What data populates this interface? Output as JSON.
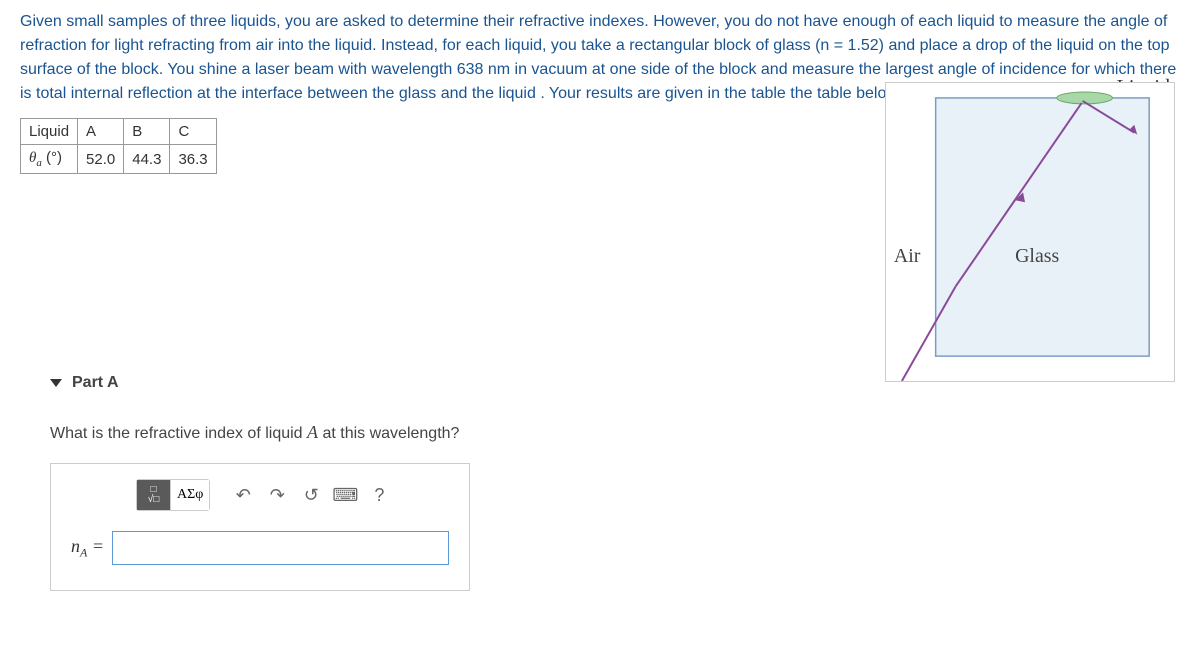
{
  "problem": {
    "text": "Given small samples of three liquids, you are asked to determine their refractive indexes. However, you do not have enough of each liquid to measure the angle of refraction for light refracting from air into the liquid. Instead, for each liquid, you take a rectangular block of glass (n = 1.52) and place a drop of the liquid on the top surface of the block. You shine a laser beam with wavelength 638 nm in vacuum at one side of the block and measure the largest angle of incidence for which there is total internal reflection at the interface between the glass and the liquid . Your results are given in the table the table below."
  },
  "figure": {
    "liquid_label": "Liquid",
    "air_label": "Air",
    "glass_label": "Glass"
  },
  "table": {
    "headers": {
      "liquid": "Liquid",
      "colA": "A",
      "colB": "B",
      "colC": "C"
    },
    "row_label_theta": "θ",
    "row_label_sub": "a",
    "row_label_unit": " (°)",
    "values": {
      "A": "52.0",
      "B": "44.3",
      "C": "36.3"
    }
  },
  "part": {
    "title": "Part A",
    "question_pre": "What is the refractive index of liquid ",
    "question_var": "A",
    "question_post": " at this wavelength?"
  },
  "toolbar": {
    "greek_label": "ΑΣφ",
    "help_label": "?"
  },
  "answer": {
    "var_prefix": "n",
    "var_sub": "A",
    "equals": " =",
    "value": ""
  }
}
